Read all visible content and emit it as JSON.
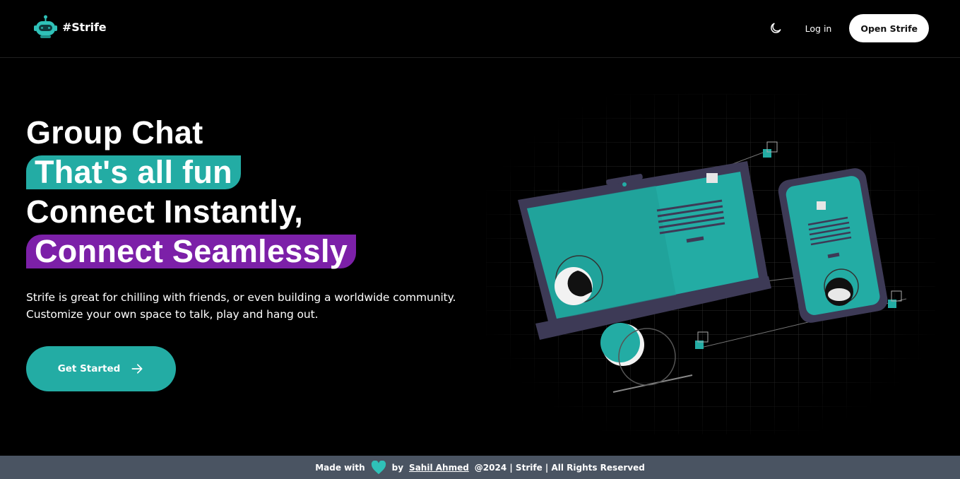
{
  "header": {
    "brand": "#Strife",
    "logo_icon": "robot-icon",
    "theme_icon": "moon-icon",
    "login_label": "Log in",
    "open_label": "Open Strife"
  },
  "hero": {
    "line1": "Group Chat",
    "line2": "That's all fun",
    "line3": "Connect Instantly,",
    "line4": "Connect Seamlessly",
    "subtitle_line1": "Strife is great for chilling with friends, or even building a worldwide community.",
    "subtitle_line2": "Customize your own space to talk, play and hang out.",
    "cta_label": "Get Started",
    "cta_icon": "arrow-right-icon"
  },
  "colors": {
    "teal": "#23aca4",
    "purple": "#7c20a8",
    "footer_bg": "#4a5462"
  },
  "footer": {
    "made_with": "Made with",
    "heart_icon": "heart-icon",
    "by": "by",
    "author": "Sahil Ahmed",
    "rights": "@2024 | Strife | All Rights Reserved"
  }
}
